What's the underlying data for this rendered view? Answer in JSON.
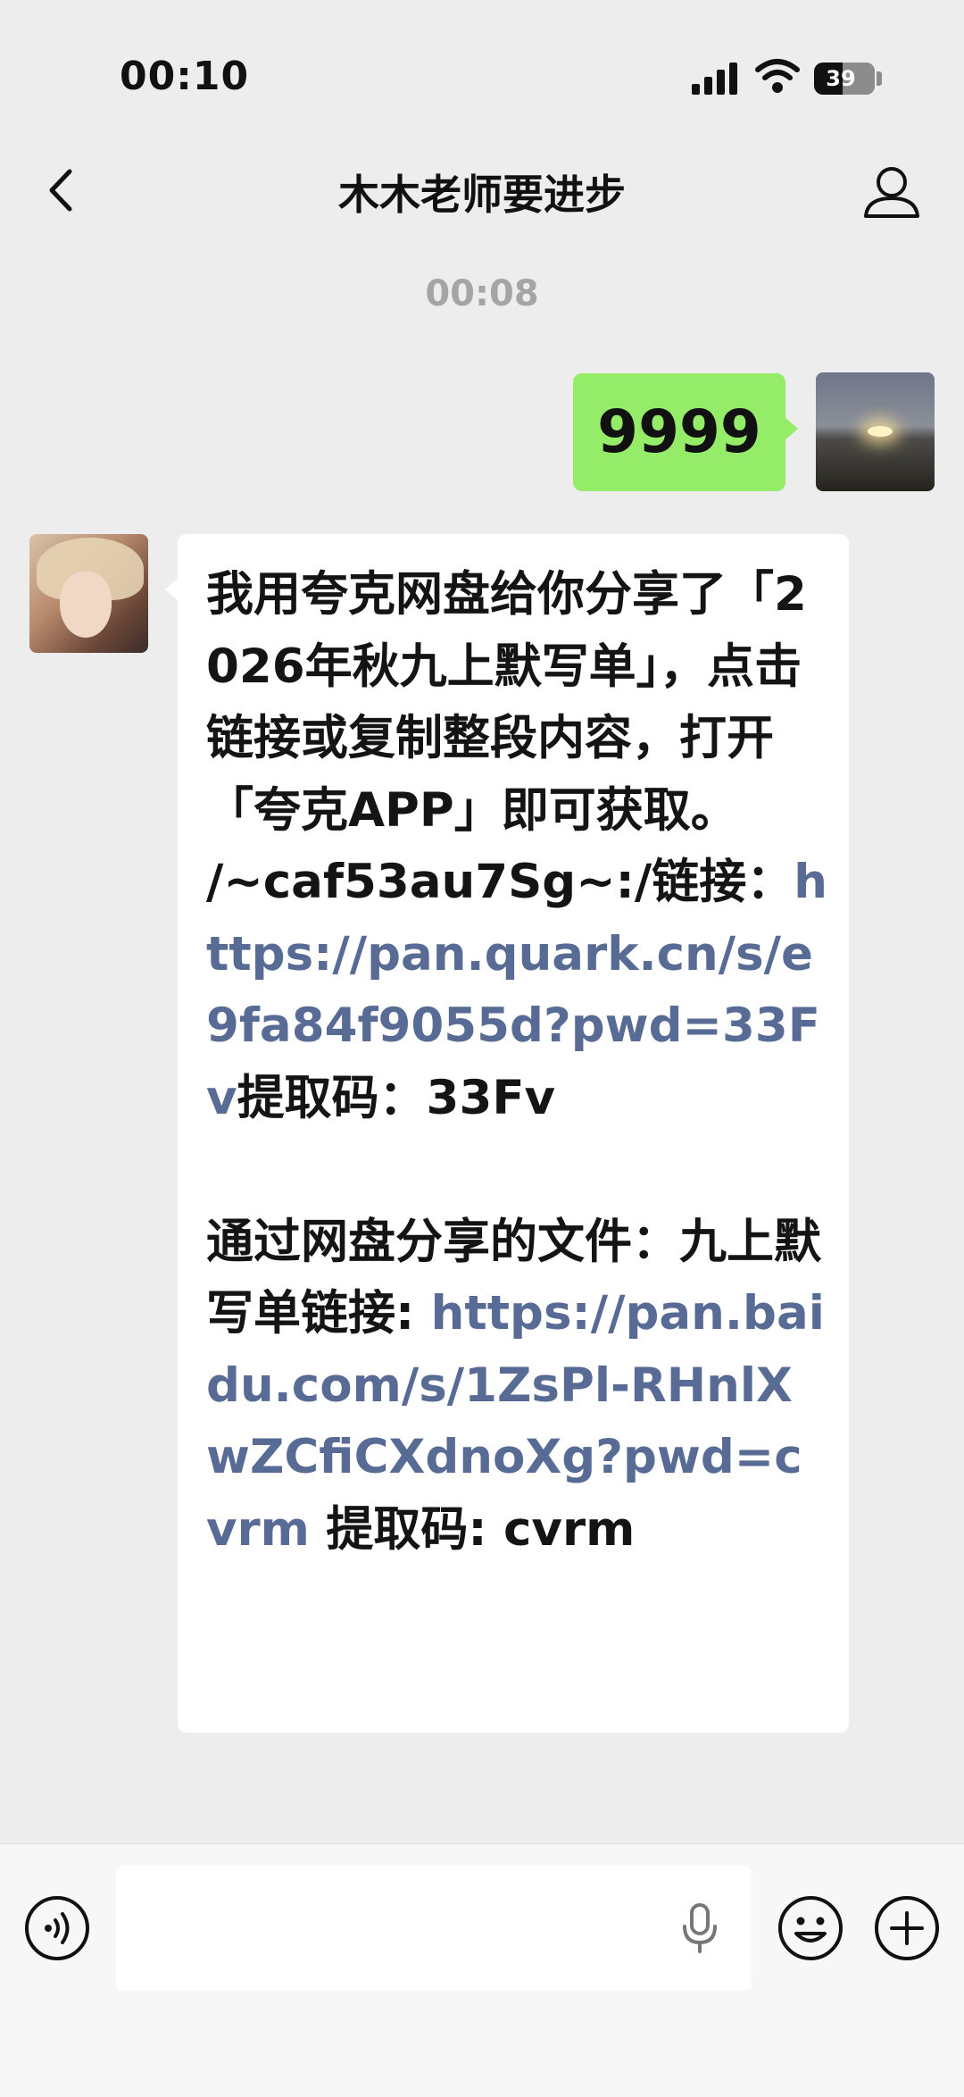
{
  "status_bar": {
    "time": "00:10",
    "battery_level": "39",
    "icons": [
      "signal-icon",
      "wifi-icon",
      "battery-icon"
    ]
  },
  "nav": {
    "title": "木木老师要进步",
    "back_icon": "chevron-left-icon",
    "profile_icon": "person-icon"
  },
  "chat": {
    "timestamp": "00:08",
    "messages": [
      {
        "sender": "self",
        "text": "9999"
      },
      {
        "sender": "other",
        "segments": [
          {
            "type": "text",
            "text": "我用夸克网盘给你分享了「2026年秋九上默写单」，点击链接或复制整段内容，打开「夸克APP」即可获取。\n/~caf53au7Sg~:/链接："
          },
          {
            "type": "link",
            "text": "https://pan.quark.cn/s/e9fa84f9055d?pwd=33Fv"
          },
          {
            "type": "text",
            "text": "提取码：33Fv\n\n通过网盘分享的文件：九上默写单链接: "
          },
          {
            "type": "link",
            "text": "https://pan.baidu.com/s/1ZsPl-RHnlXwZCfiCXdnoXg?pwd=cvrm"
          },
          {
            "type": "text",
            "text": " 提取码: cvrm"
          }
        ]
      }
    ]
  },
  "input_bar": {
    "placeholder": "",
    "value": "",
    "icons": [
      "voice-icon",
      "microphone-icon",
      "emoji-icon",
      "plus-icon"
    ]
  },
  "colors": {
    "background": "#ededed",
    "self_bubble": "#95ec69",
    "other_bubble": "#ffffff",
    "link": "#576b95",
    "timestamp": "#a5a5a5"
  }
}
